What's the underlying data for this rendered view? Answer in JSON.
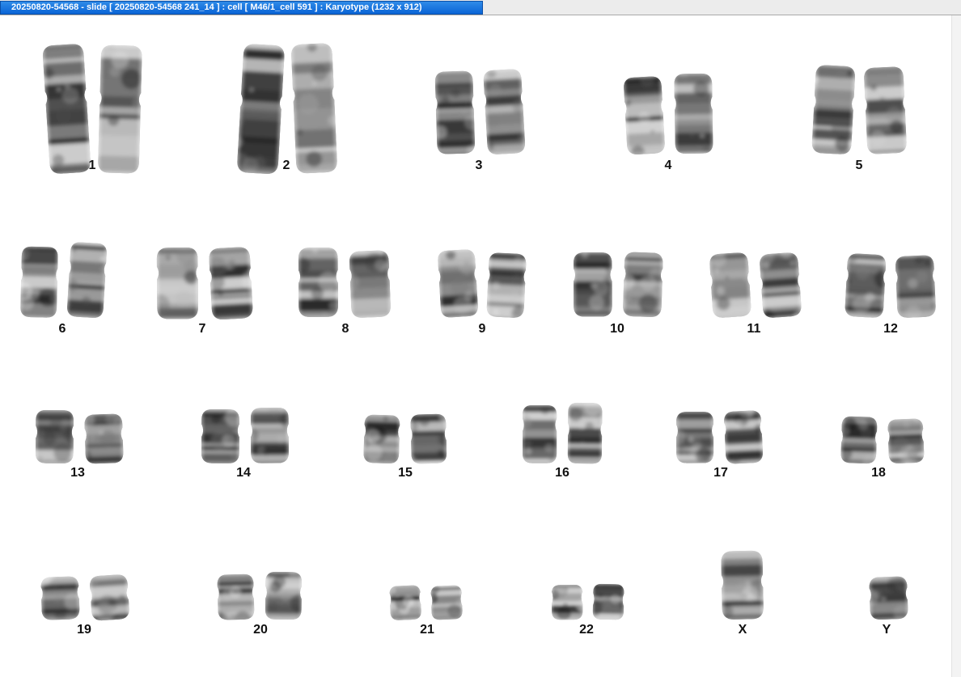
{
  "window": {
    "title": "20250820-54568 - slide [ 20250820-54568 241_14 ] : cell [ M46/1_cell 591 ] : Karyotype  (1232 x 912)"
  },
  "karyotype": {
    "pairs": [
      {
        "label": "1"
      },
      {
        "label": "2"
      },
      {
        "label": "3"
      },
      {
        "label": "4"
      },
      {
        "label": "5"
      },
      {
        "label": "6"
      },
      {
        "label": "7"
      },
      {
        "label": "8"
      },
      {
        "label": "9"
      },
      {
        "label": "10"
      },
      {
        "label": "11"
      },
      {
        "label": "12"
      },
      {
        "label": "13"
      },
      {
        "label": "14"
      },
      {
        "label": "15"
      },
      {
        "label": "16"
      },
      {
        "label": "17"
      },
      {
        "label": "18"
      },
      {
        "label": "19"
      },
      {
        "label": "20"
      },
      {
        "label": "21"
      },
      {
        "label": "22"
      },
      {
        "label": "X"
      },
      {
        "label": "Y"
      }
    ]
  }
}
